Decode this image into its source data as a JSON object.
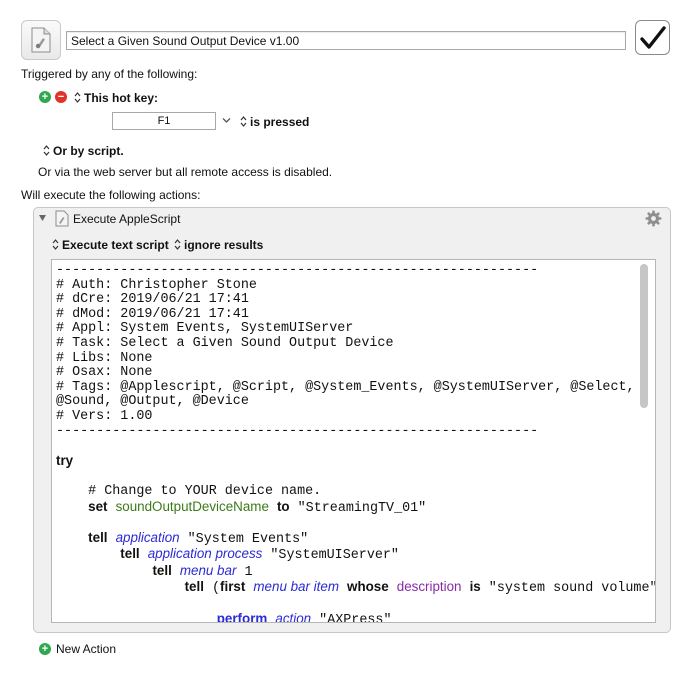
{
  "macro": {
    "name": "Select a Given Sound Output Device v1.00",
    "enabled_icon": "checkmark-icon",
    "icon": "applescript-document-icon"
  },
  "trigger": {
    "heading": "Triggered by any of the following:",
    "hotkey_label": "This hot key:",
    "hotkey_value": "F1",
    "hotkey_state": "is pressed",
    "by_script_label": "Or by script.",
    "web_server_text": "Or via the web server but all remote access is disabled."
  },
  "actions": {
    "heading": "Will execute the following actions:",
    "action_title": "Execute AppleScript",
    "mode_label": "Execute text script",
    "results_label": "ignore results",
    "new_action_label": "New Action"
  },
  "script": {
    "header_lines": [
      "------------------------------------------------------------",
      "# Auth: Christopher Stone",
      "# dCre: 2019/06/21 17:41",
      "# dMod: 2019/06/21 17:41",
      "# Appl: System Events, SystemUIServer",
      "# Task: Select a Given Sound Output Device",
      "# Libs: None",
      "# Osax: None",
      "# Tags: @Applescript, @Script, @System_Events, @SystemUIServer, @Select,",
      "@Sound, @Output, @Device",
      "# Vers: 1.00",
      "------------------------------------------------------------"
    ],
    "kw_try": "try",
    "comment_change": "# Change to YOUR device name.",
    "kw_set": "set",
    "var_name": "soundOutputDeviceName",
    "kw_to": "to",
    "str_device": "\"StreamingTV_01\"",
    "kw_tell": "tell",
    "cls_application": "application",
    "str_system_events": "\"System Events\"",
    "cls_application_process": "application process",
    "str_systemuiserver": "\"SystemUIServer\"",
    "cls_menu_bar": "menu bar",
    "num_1": "1",
    "paren_open": "(",
    "kw_first": "first",
    "cls_menu_bar_item": "menu bar item",
    "kw_whose": "whose",
    "prop_description": "description",
    "kw_is": "is",
    "str_volume": "\"system sound volume\")",
    "kw_perform": "perform",
    "cls_action": "action",
    "str_axpress": "\"AXPress\""
  },
  "colors": {
    "keyword_blue": "#2b2bd4",
    "variable_green": "#3d7a1a",
    "property_purple": "#8a2aa8",
    "add_green": "#2fa84f",
    "remove_red": "#e0342b"
  }
}
